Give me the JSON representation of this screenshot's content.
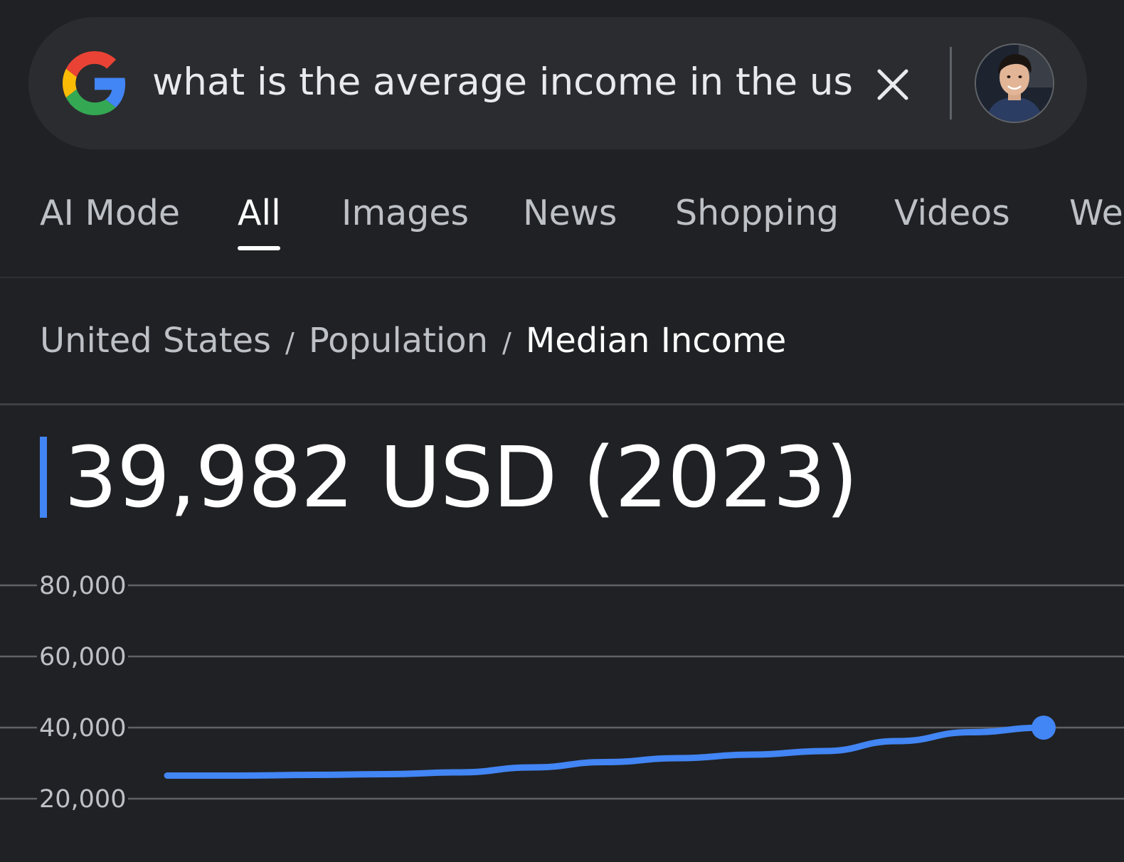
{
  "search": {
    "query": "what is the average income in the us",
    "logo_icon": "google-g-icon",
    "clear_icon": "close-icon"
  },
  "tabs": [
    {
      "label": "AI Mode",
      "active": false
    },
    {
      "label": "All",
      "active": true
    },
    {
      "label": "Images",
      "active": false
    },
    {
      "label": "News",
      "active": false
    },
    {
      "label": "Shopping",
      "active": false
    },
    {
      "label": "Videos",
      "active": false
    },
    {
      "label": "We",
      "active": false
    }
  ],
  "breadcrumb": {
    "items": [
      "United States",
      "Population",
      "Median Income"
    ],
    "separator": "/"
  },
  "headline": {
    "value_text": "39,982 USD (2023)"
  },
  "colors": {
    "background": "#202124",
    "accent": "#4285f4"
  },
  "chart_data": {
    "type": "line",
    "title": "",
    "xlabel": "",
    "ylabel": "",
    "ylim": [
      13000,
      80000
    ],
    "yticks": [
      80000,
      60000,
      40000,
      20000
    ],
    "ytick_labels": [
      "80,000",
      "60,000",
      "40,000",
      "20,000"
    ],
    "grid": true,
    "x": [
      0,
      1,
      2,
      3,
      4,
      5,
      6,
      7,
      8,
      9,
      10,
      11,
      12
    ],
    "series": [
      {
        "values": [
          26500,
          26500,
          26700,
          26900,
          27400,
          28800,
          30300,
          31400,
          32400,
          33400,
          36200,
          38700,
          39982
        ],
        "color": "#4285f4",
        "end_marker": true
      }
    ]
  }
}
